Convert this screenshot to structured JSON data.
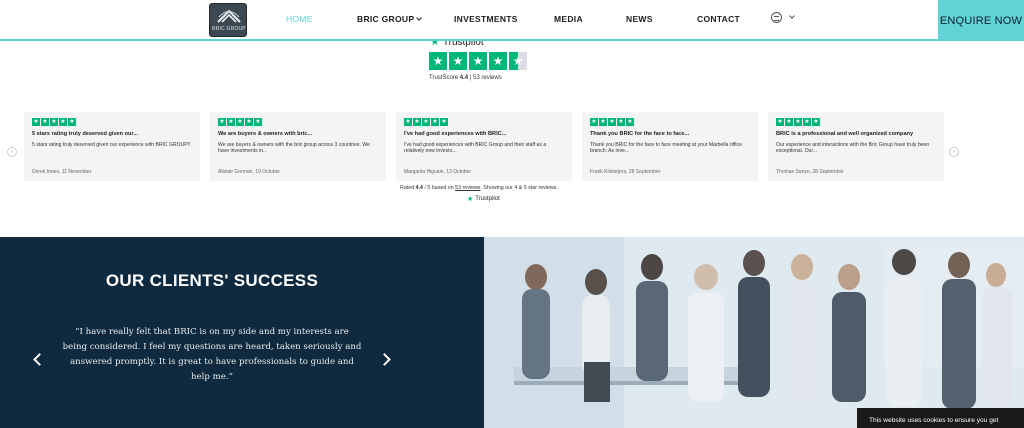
{
  "header": {
    "logo_text": "BRIC GROUP",
    "nav": [
      {
        "label": "HOME",
        "active": true
      },
      {
        "label": "BRIC GROUP",
        "dropdown": true
      },
      {
        "label": "INVESTMENTS"
      },
      {
        "label": "MEDIA"
      },
      {
        "label": "NEWS"
      },
      {
        "label": "CONTACT"
      }
    ],
    "language_icon": "translate-icon",
    "cta_label": "ENQUIRE NOW",
    "accent_color": "#5fd3d6"
  },
  "trustpilot": {
    "brand": "Trustpilot",
    "brand_color": "#00b67a",
    "score_label": "TrustScore",
    "score": "4.4",
    "reviews_count": "53 reviews",
    "stars_rating": 4.5,
    "reviews": [
      {
        "title": "5 stars rating truly deserved given our...",
        "body": "5 stars rating truly deserved given our experience with BRIC GROUP!!",
        "author": "Derek Innes, 11 November"
      },
      {
        "title": "We are buyers & owners with bric...",
        "body": "We are buyers & owners with the bric group across 3 countries. We have investments in...",
        "author": "Alistair Gorman, 19 October"
      },
      {
        "title": "I've had good experiences with BRIC...",
        "body": "I've had good experiences with BRIC Group and their staff as a relatively new investo...",
        "author": "Margarita Higuain, 13 October"
      },
      {
        "title": "Thank you BRIC for the face to face...",
        "body": "Thank you BRIC for the face to face meeting at your Marbella office branch. As inve...",
        "author": "Frank Klisterjers, 28 September"
      },
      {
        "title": "BRIC is a professional and well organized company",
        "body": "Our experience and interactions with the Bric Group have truly been exceptional. Our...",
        "author": "Thomas Sanyo, 28 September"
      }
    ],
    "rated_prefix": "Rated",
    "rated_value": "4.4",
    "rated_mid": "/ 5 based on",
    "rated_link": "53 reviews",
    "rated_suffix": ". Showing our 4 & 5 star reviews."
  },
  "clients": {
    "title": "OUR CLIENTS' SUCCESS",
    "quote": "“I have really felt that BRIC is on my side and my interests are being considered. I feel my questions are heard, taken seriously and answered promptly. It is great to have professionals to guide and help me.”",
    "bg_color": "#0f2a3e"
  },
  "cookie": {
    "text": "This website uses cookies to ensure you get"
  }
}
